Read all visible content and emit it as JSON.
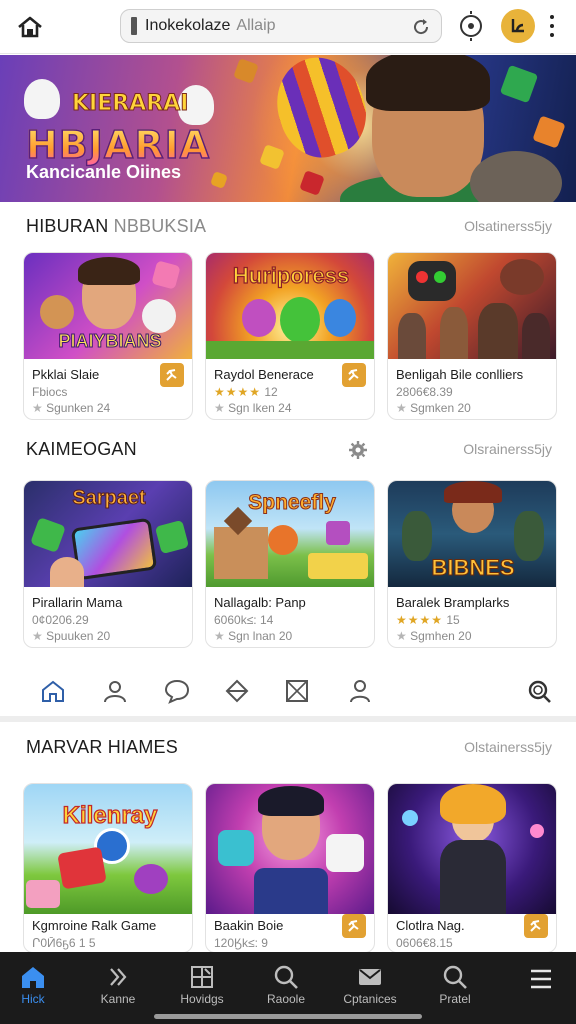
{
  "browser": {
    "url_main": "Inokekolaze",
    "url_sub": "Allaip",
    "icons": [
      "home-icon",
      "reload-icon",
      "extension-icon",
      "profile-icon",
      "menu-dots-icon"
    ],
    "accent": "#e8b33a"
  },
  "hero": {
    "kicker": "KIERARAI",
    "title": "HBJARIA",
    "subtitle": "Kancicanle Oiines"
  },
  "sections": [
    {
      "title_main": "HIBURAN",
      "title_muted": "NBBUKSIA",
      "link": "Olsatinerss5jy",
      "cards": [
        {
          "name": "Pkklai Slaie",
          "meta": "Fbiocs",
          "foot": "Sgunken 24",
          "badge": true,
          "thumb_text": "PIAIYBIANS"
        },
        {
          "name": "Raydol Benerace",
          "stars": "★★★★",
          "meta": "12",
          "foot": "Sgn lken 24",
          "badge": true,
          "thumb_text": "Huriporess"
        },
        {
          "name": "Benligah Bile conlliers",
          "meta": "2806€8.39",
          "foot": "Sgmken 20",
          "badge": false,
          "thumb_text": ""
        }
      ]
    },
    {
      "title_main": "KAIMEOGAN",
      "title_muted": "",
      "link": "Olsrainerss5jy",
      "cards": [
        {
          "name": "Pirallarin Mama",
          "meta": "0¢0206.29",
          "foot": "Spuuken 20",
          "badge": false,
          "thumb_text": "Sarpaet"
        },
        {
          "name": "Nallagalb: Panp",
          "meta": "6060k≤: 14",
          "foot": "Sgn lnan 20",
          "badge": false,
          "thumb_text": "Spneefly"
        },
        {
          "name": "Baralek Bramplarks",
          "stars": "★★★★",
          "meta": "15",
          "foot": "Sgmhen 20",
          "badge": false,
          "thumb_text": "BIBNES"
        }
      ]
    },
    {
      "title_main": "MARVAR HIAMES",
      "title_muted": "",
      "link": "Olstainerss5jy",
      "cards": [
        {
          "name": "Kgmroine Ralk Game",
          "meta": "Ր0Ӣ6ҕ6 1 5",
          "badge": false,
          "thumb_text": "Kilenray"
        },
        {
          "name": "Baakin Boie",
          "meta": "120Ӄk≤: 9",
          "badge": true,
          "thumb_text": ""
        },
        {
          "name": "Clotlra Nag.",
          "meta": "0606€8.15",
          "badge": true,
          "thumb_text": ""
        }
      ]
    }
  ],
  "icon_row": [
    "home-outline-icon",
    "user-icon",
    "chat-icon",
    "diamond-icon",
    "frame-icon",
    "person-icon",
    "search-icon"
  ],
  "bottom_nav": [
    {
      "label": "Hick",
      "icon": "home-icon",
      "active": true
    },
    {
      "label": "Kanne",
      "icon": "chevrons-icon",
      "active": false
    },
    {
      "label": "Hovidgs",
      "icon": "grid-icon",
      "active": false
    },
    {
      "label": "Raoole",
      "icon": "search-icon",
      "active": false
    },
    {
      "label": "Cptanices",
      "icon": "mail-icon",
      "active": false
    },
    {
      "label": "Pratel",
      "icon": "search-icon",
      "active": false
    },
    {
      "label": "",
      "icon": "hamburger-icon",
      "active": false
    }
  ]
}
